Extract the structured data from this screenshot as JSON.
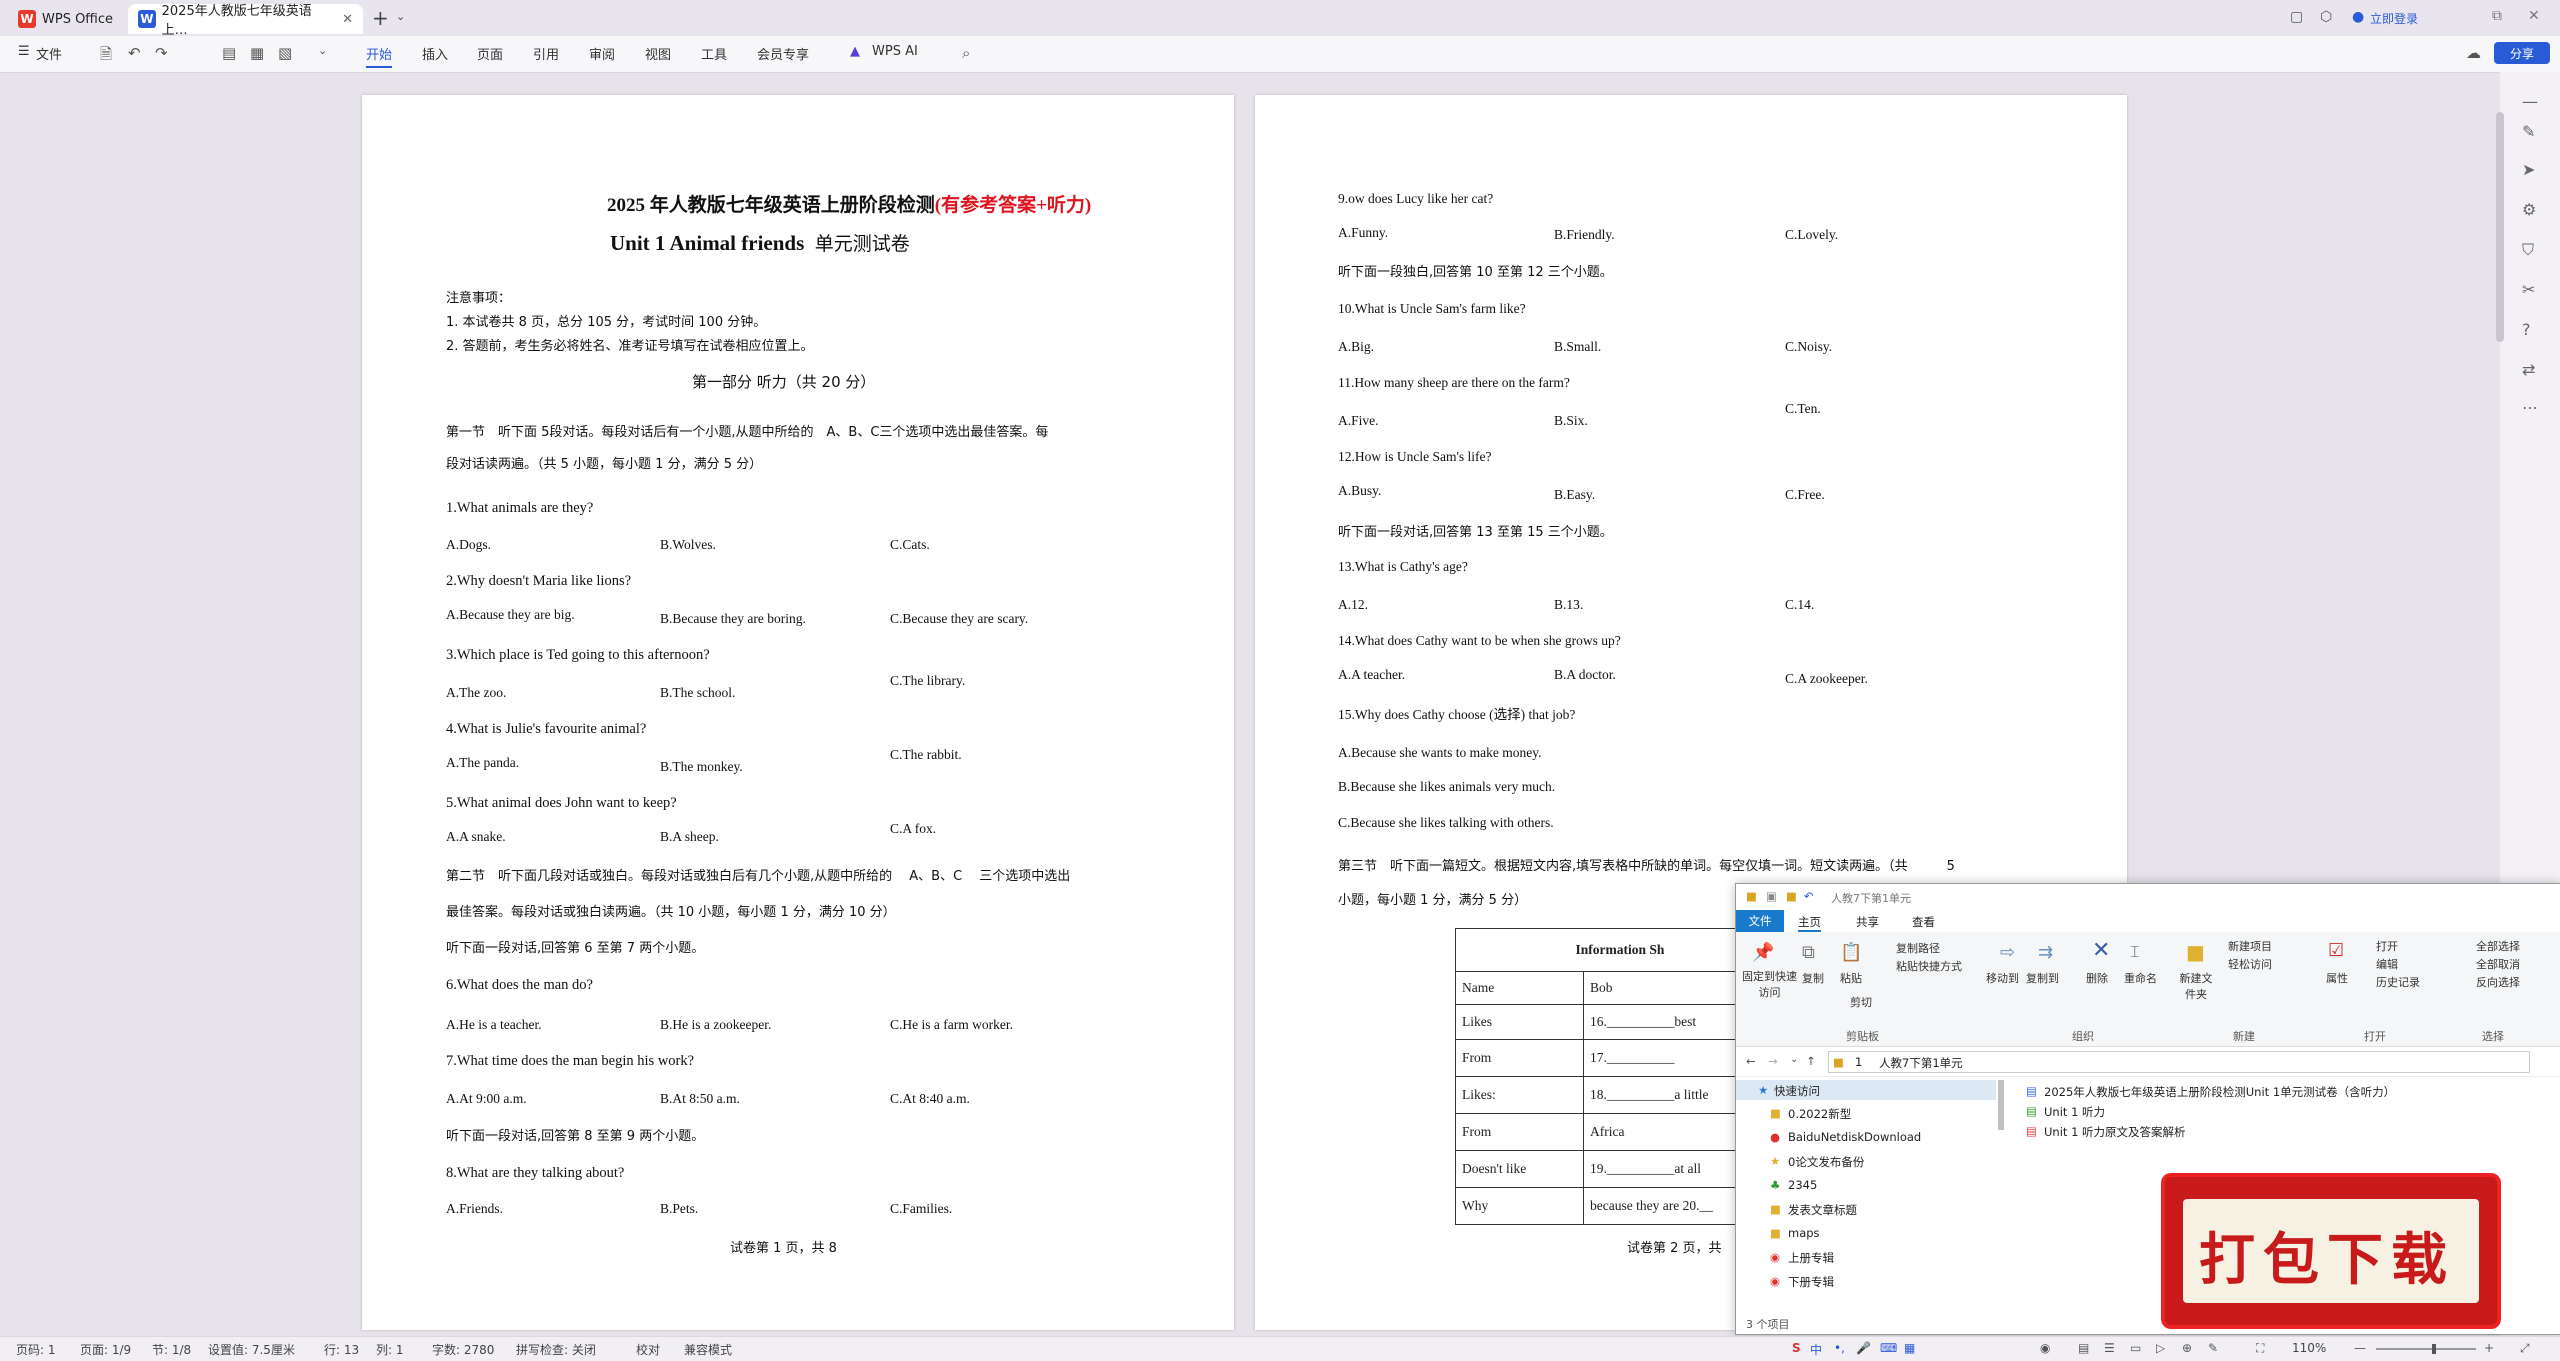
{
  "app": {
    "tab1": "WPS Office",
    "tab2": "2025年人教版七年级英语上…",
    "login": "立即登录",
    "share": "分享"
  },
  "menu": {
    "file": "文件",
    "items": [
      "开始",
      "插入",
      "页面",
      "引用",
      "审阅",
      "视图",
      "工具",
      "会员专享",
      "WPS AI"
    ]
  },
  "page1": {
    "title_a": "2025 年人教版七年级英语上册阶段检测",
    "title_b": "(有参考答案+听力)",
    "subtitle_a": "Unit 1 Animal friends",
    "subtitle_b": "单元测试卷",
    "notes_head": "注意事项：",
    "note1": "1. 本试卷共 8 页，总分 105 分，考试时间 100 分钟。",
    "note2": "2. 答题前，考生务必将姓名、准考证号填写在试卷相应位置上。",
    "part1": "第一部分 听力（共 20 分）",
    "sec1_a": "第一节　听下面 5段对话。每段对话后有一个小题,从题中所给的　A、B、C三个选项中选出最佳答案。每",
    "sec1_b": "段对话读两遍。（共 5 小题，每小题 1 分，满分 5 分）",
    "q1": "1.What animals are they?",
    "q1a": "A.Dogs.",
    "q1b": "B.Wolves.",
    "q1c": "C.Cats.",
    "q2": "2.Why doesn't Maria like lions?",
    "q2a": "A.Because they are big.",
    "q2b": "B.Because they are boring.",
    "q2c": "C.Because they are scary.",
    "q3": "3.Which place is Ted going to this afternoon?",
    "q3a": "A.The zoo.",
    "q3b": "B.The school.",
    "q3c": "C.The library.",
    "q4": "4.What is Julie's favourite animal?",
    "q4a": "A.The panda.",
    "q4b": "B.The monkey.",
    "q4c": "C.The rabbit.",
    "q5": "5.What animal does John want to keep?",
    "q5a": "A.A snake.",
    "q5b": "B.A sheep.",
    "q5c": "C.A fox.",
    "sec2_a": "第二节　听下面几段对话或独白。每段对话或独白后有几个小题,从题中所给的　 A、B、C　 三个选项中选出",
    "sec2_b": "最佳答案。每段对话或独白读两遍。（共 10 小题，每小题 1 分，满分 10 分）",
    "inst1": "听下面一段对话,回答第 6 至第 7 两个小题。",
    "q6": "6.What does the man do?",
    "q6a": "A.He is a teacher.",
    "q6b": "B.He is a zookeeper.",
    "q6c": "C.He is a farm worker.",
    "q7": "7.What time does the man begin his work?",
    "q7a": "A.At 9:00 a.m.",
    "q7b": "B.At 8:50 a.m.",
    "q7c": "C.At 8:40 a.m.",
    "inst2": "听下面一段对话,回答第 8 至第 9 两个小题。",
    "q8": "8.What are they talking about?",
    "q8a": "A.Friends.",
    "q8b": "B.Pets.",
    "q8c": "C.Families.",
    "footer": "试卷第 1 页，共 8"
  },
  "page2": {
    "q9": "9.ow does Lucy like her cat?",
    "q9a": "A.Funny.",
    "q9b": "B.Friendly.",
    "q9c": "C.Lovely.",
    "inst1": "听下面一段独白,回答第 10 至第 12 三个小题。",
    "q10": "10.What is Uncle Sam's farm like?",
    "q10a": "A.Big.",
    "q10b": "B.Small.",
    "q10c": "C.Noisy.",
    "q11": "11.How many sheep are there on the farm?",
    "q11a": "A.Five.",
    "q11b": "B.Six.",
    "q11c": "C.Ten.",
    "q12": "12.How is Uncle Sam's life?",
    "q12a": "A.Busy.",
    "q12b": "B.Easy.",
    "q12c": "C.Free.",
    "inst2": "听下面一段对话,回答第 13 至第 15 三个小题。",
    "q13": "13.What is Cathy's age?",
    "q13a": "A.12.",
    "q13b": "B.13.",
    "q13c": "C.14.",
    "q14": "14.What does Cathy want to be when she grows up?",
    "q14a": "A.A teacher.",
    "q14b": "B.A doctor.",
    "q14c": "C.A zookeeper.",
    "q15": "15.Why does Cathy choose (选择) that job?",
    "q15a": "A.Because she wants to make money.",
    "q15b": "B.Because she likes animals very much.",
    "q15c": "C.Because she likes talking with others.",
    "sec3_a": "第三节　听下面一篇短文。根据短文内容,填写表格中所缺的单词。每空仅填一词。短文读两遍。（共　　　5",
    "sec3_b": "小题，每小题 1 分，满分 5 分）",
    "table_title": "Information Sh",
    "rows": [
      {
        "k": "Name",
        "v": "Bob"
      },
      {
        "k": "Likes",
        "v": "16.__________best"
      },
      {
        "k": "From",
        "v": "17.__________"
      },
      {
        "k": "Likes:",
        "v": "18.__________a little"
      },
      {
        "k": "From",
        "v": "Africa"
      },
      {
        "k": "Doesn't like",
        "v": "19.__________at all"
      },
      {
        "k": "Why",
        "v": "because they are 20.__"
      }
    ],
    "footer": "试卷第 2 页，共"
  },
  "explorer": {
    "title": "人教7下第1单元",
    "tabs": [
      "文件",
      "主页",
      "共享",
      "查看"
    ],
    "ribbon": {
      "pin": "固定到快速访问",
      "copy": "复制",
      "paste": "粘贴",
      "copy_path": "复制路径",
      "paste_shortcut": "粘贴快捷方式",
      "cut": "剪切",
      "move_to": "移动到",
      "copy_to": "复制到",
      "delete": "删除",
      "rename": "重命名",
      "new_folder": "新建文件夹",
      "new_item": "新建项目",
      "easy_access": "轻松访问",
      "properties": "属性",
      "open": "打开",
      "edit": "编辑",
      "history": "历史记录",
      "select_all": "全部选择",
      "select_none": "全部取消",
      "invert": "反向选择"
    },
    "groups": [
      "剪贴板",
      "组织",
      "新建",
      "打开",
      "选择"
    ],
    "path": [
      "1",
      "人教7下第1单元"
    ],
    "nav": [
      "快速访问",
      "0.2022新型",
      "BaiduNetdiskDownload",
      "0论文发布备份",
      "2345",
      "发表文章标题",
      "maps",
      "上册专辑",
      "下册专辑"
    ],
    "files": [
      "2025年人教版七年级英语上册阶段检测Unit 1单元测试卷（含听力）",
      "Unit 1 听力",
      "Unit 1 听力原文及答案解析"
    ],
    "count": "3 个项目"
  },
  "banner": "打包下载",
  "status": {
    "page": "页码: 1",
    "pages": "页面: 1/9",
    "section": "节: 1/8",
    "setting": "设置值: 7.5厘米",
    "row": "行: 13",
    "col": "列: 1",
    "words": "字数: 2780",
    "spell": "拼写检查: 关闭",
    "proof": "校对",
    "compat": "兼容模式",
    "zoom": "110%"
  }
}
